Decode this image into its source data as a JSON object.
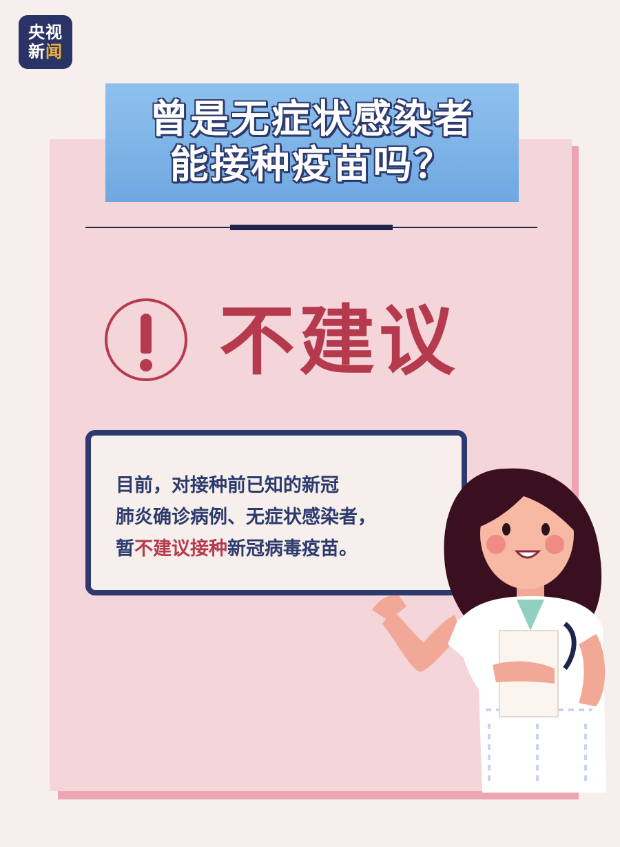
{
  "logo": {
    "line1": "央视",
    "line2_a": "新",
    "line2_b": "闻"
  },
  "title": {
    "line1": "曾是无症状感染者",
    "line2": "能接种疫苗吗？"
  },
  "headline": "不建议",
  "info": {
    "line1": "目前，对接种前已知的新冠",
    "line2": "肺炎确诊病例、无症状感染者，",
    "line3_pre": "暂",
    "line3_em": "不建议接种",
    "line3_post": "新冠病毒疫苗。"
  },
  "colors": {
    "navy": "#2c3a6e",
    "red": "#b53a4e",
    "pink": "#f4d5da",
    "blue": "#7ab2e6"
  },
  "icons": {
    "warning": "exclamation-circle-icon"
  }
}
